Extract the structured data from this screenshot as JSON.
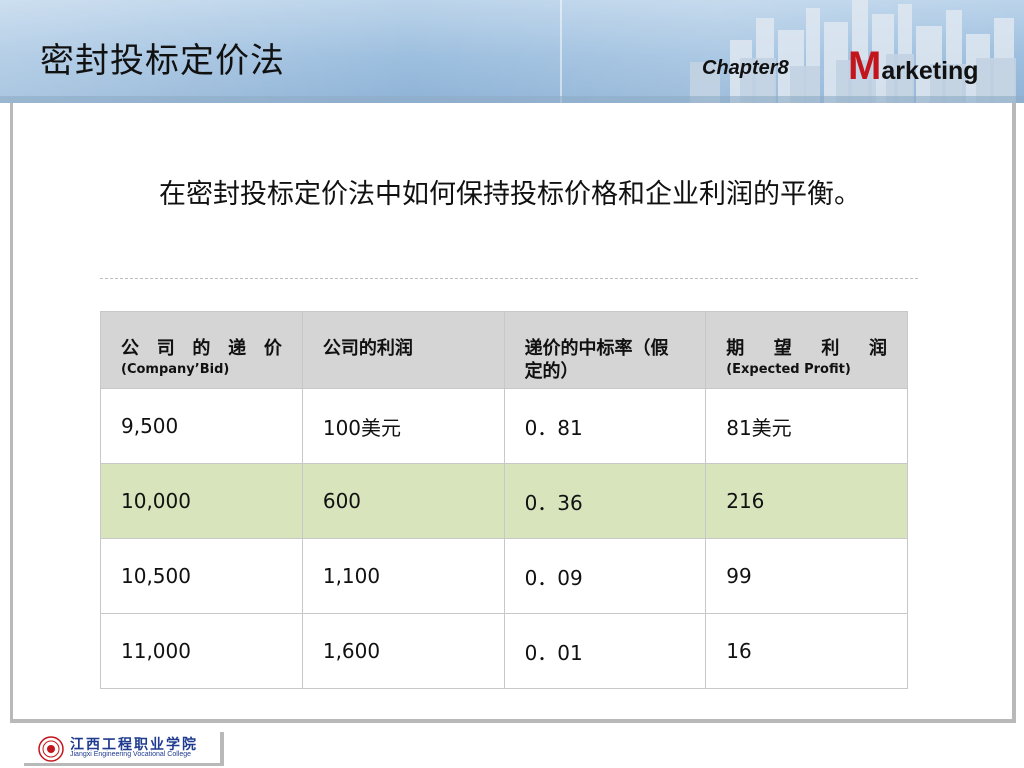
{
  "header": {
    "title": "密封投标定价法",
    "chapter": "Chapter8",
    "marketing_initial": "M",
    "marketing_rest": "arketing",
    "accent_color": "#c3161c"
  },
  "main": {
    "question": "在密封投标定价法中如何保持投标价格和企业利润的平衡。"
  },
  "table": {
    "headers": [
      {
        "main": "公 司 的 递 价",
        "sub": "(Company’Bid)"
      },
      {
        "main": "公司的利润",
        "sub": ""
      },
      {
        "main": "递价的中标率（假定的）",
        "sub": ""
      },
      {
        "main": "期 望 利 润",
        "sub": "(Expected Profit)"
      }
    ],
    "rows": [
      [
        "9,500",
        "100美元",
        "0．81",
        "81美元"
      ],
      [
        "10,000",
        "600",
        "0．36",
        "216"
      ],
      [
        "10,500",
        "1,100",
        "0．09",
        "99"
      ],
      [
        "11,000",
        "1,600",
        "0．01",
        "16"
      ]
    ],
    "highlight_row_color": "#d7e4bc"
  },
  "footer": {
    "college_cn": "江西工程职业学院",
    "college_en": "Jiangxi Engineering Vocational College",
    "logo_icon": "college-seal-icon"
  }
}
